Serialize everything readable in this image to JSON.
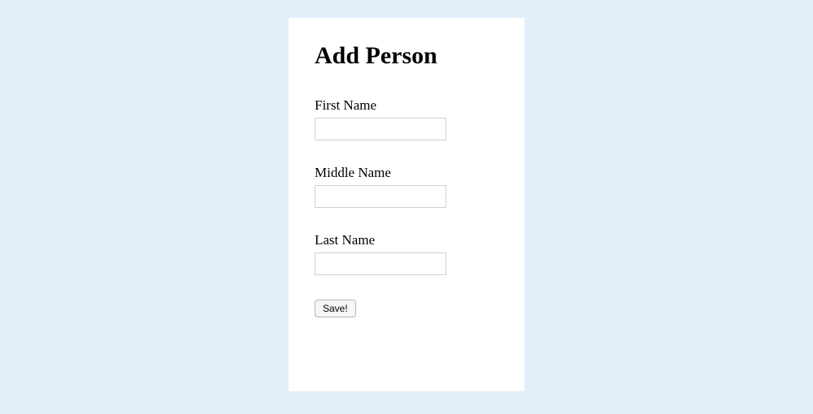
{
  "title": "Add Person",
  "form": {
    "fields": {
      "first_name": {
        "label": "First Name",
        "value": ""
      },
      "middle_name": {
        "label": "Middle Name",
        "value": ""
      },
      "last_name": {
        "label": "Last Name",
        "value": ""
      }
    },
    "save_button": "Save!"
  }
}
